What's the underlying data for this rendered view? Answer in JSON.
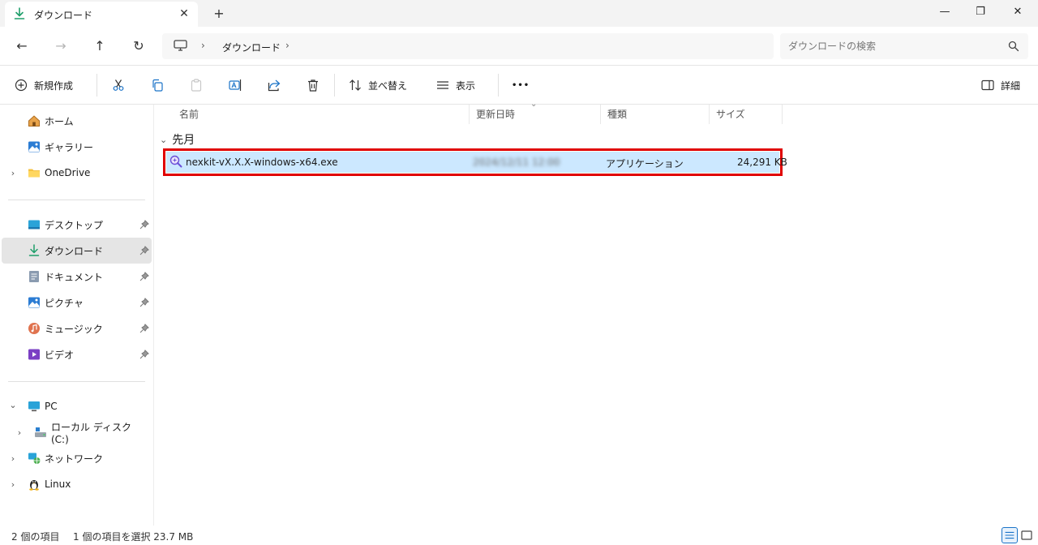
{
  "window": {
    "tab_title": "ダウンロード",
    "tab_close": "✕",
    "new_tab": "+",
    "minimize": "—",
    "maximize": "❐",
    "close": "✕"
  },
  "nav": {
    "back": "←",
    "forward": "→",
    "up": "↑",
    "refresh": "↻",
    "breadcrumb": [
      "ダウンロード"
    ],
    "separator": "›",
    "search_placeholder": "ダウンロードの検索"
  },
  "commands": {
    "new_label": "新規作成",
    "sort_label": "並べ替え",
    "view_label": "表示",
    "more_label": "•••",
    "details_label": "詳細"
  },
  "sidebar": {
    "top": [
      {
        "label": "ホーム",
        "icon": "home-icon"
      },
      {
        "label": "ギャラリー",
        "icon": "gallery-icon"
      },
      {
        "label": "OneDrive",
        "icon": "folder-icon",
        "expand": "›"
      }
    ],
    "pinned": [
      {
        "label": "デスクトップ",
        "icon": "desktop-icon"
      },
      {
        "label": "ダウンロード",
        "icon": "download-icon",
        "selected": true
      },
      {
        "label": "ドキュメント",
        "icon": "document-icon"
      },
      {
        "label": "ピクチャ",
        "icon": "picture-icon"
      },
      {
        "label": "ミュージック",
        "icon": "music-icon"
      },
      {
        "label": "ビデオ",
        "icon": "video-icon"
      }
    ],
    "devices": [
      {
        "label": "PC",
        "icon": "pc-icon",
        "expand": "⌄"
      },
      {
        "label": "ローカル ディスク (C:)",
        "icon": "drive-icon",
        "expand": "›"
      },
      {
        "label": "ネットワーク",
        "icon": "network-icon",
        "expand": "›"
      },
      {
        "label": "Linux",
        "icon": "linux-icon",
        "expand": "›"
      }
    ]
  },
  "columns": {
    "name": "名前",
    "modified": "更新日時",
    "type": "種類",
    "size": "サイズ"
  },
  "group": {
    "label": "先月",
    "chevron": "⌄"
  },
  "file": {
    "name": "nexkit-vX.X.X-windows-x64.exe",
    "modified": "2024/12/11 12:00",
    "type": "アプリケーション",
    "size": "24,291 KB"
  },
  "status": {
    "item_count": "2 個の項目",
    "selection": "1 個の項目を選択  23.7 MB"
  },
  "colors": {
    "accent": "#1a73c8",
    "selection_bg": "#cce8ff",
    "highlight_border": "#e00000",
    "download_green": "#1e9e6a"
  }
}
